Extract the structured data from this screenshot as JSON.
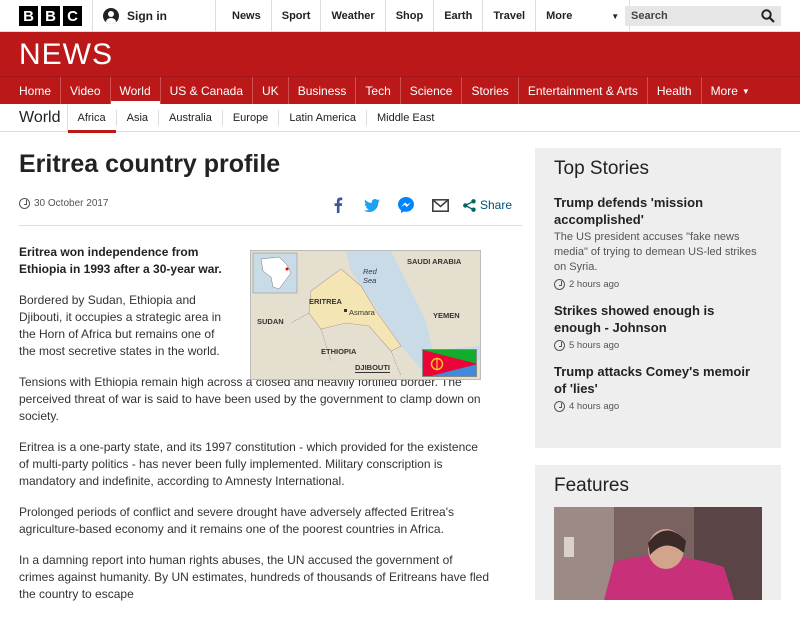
{
  "topbar": {
    "logo_letters": [
      "B",
      "B",
      "C"
    ],
    "signin_label": "Sign in",
    "nav": [
      "News",
      "Sport",
      "Weather",
      "Shop",
      "Earth",
      "Travel"
    ],
    "more_label": "More",
    "search_placeholder": "Search"
  },
  "news_logo": "NEWS",
  "main_nav": {
    "items": [
      "Home",
      "Video",
      "World",
      "US & Canada",
      "UK",
      "Business",
      "Tech",
      "Science",
      "Stories",
      "Entertainment & Arts",
      "Health"
    ],
    "active": "World",
    "more_label": "More"
  },
  "sub_nav": {
    "section": "World",
    "items": [
      "Africa",
      "Asia",
      "Australia",
      "Europe",
      "Latin America",
      "Middle East"
    ],
    "active": "Africa"
  },
  "article": {
    "title": "Eritrea country profile",
    "date": "30 October 2017",
    "share_label": "Share",
    "share_icons": [
      "facebook-icon",
      "twitter-icon",
      "messenger-icon",
      "email-icon",
      "share-icon"
    ],
    "paragraphs": [
      "Eritrea won independence from Ethiopia in 1993 after a 30-year war.",
      "Bordered by Sudan, Ethiopia and Djibouti, it occupies a strategic area in the Horn of Africa but remains one of the most secretive states in the world.",
      "Tensions with Ethiopia remain high across a closed and heavily fortified border. The perceived threat of war is said to have been used by the government to clamp down on society.",
      "Eritrea is a one-party state, and its 1997 constitution - which provided for the existence of multi-party politics - has never been fully implemented. Military conscription is mandatory and indefinite, according to Amnesty International.",
      "Prolonged periods of conflict and severe drought have adversely affected Eritrea's agriculture-based economy and it remains one of the poorest countries in Africa.",
      "In a damning report into human rights abuses, the UN accused the government of crimes against humanity. By UN estimates, hundreds of thousands of Eritreans have fled the country to escape"
    ],
    "map_labels": {
      "saudi": "SAUDI ARABIA",
      "red_sea": "Red Sea",
      "eritrea": "ERITREA",
      "asmara": "Asmara",
      "sudan": "SUDAN",
      "yemen": "YEMEN",
      "ethiopia": "ETHIOPIA",
      "djibouti": "DJIBOUTI"
    }
  },
  "top_stories": {
    "title": "Top Stories",
    "stories": [
      {
        "headline": "Trump defends 'mission accomplished'",
        "summary": "The US president accuses \"fake news media\" of trying to demean US-led strikes on Syria.",
        "time": "2 hours ago"
      },
      {
        "headline": "Strikes showed enough is enough - Johnson",
        "summary": "",
        "time": "5 hours ago"
      },
      {
        "headline": "Trump attacks Comey's memoir of 'lies'",
        "summary": "",
        "time": "4 hours ago"
      }
    ]
  },
  "features": {
    "title": "Features"
  },
  "colors": {
    "brand_red": "#bb1919",
    "link_blue": "#005177"
  }
}
